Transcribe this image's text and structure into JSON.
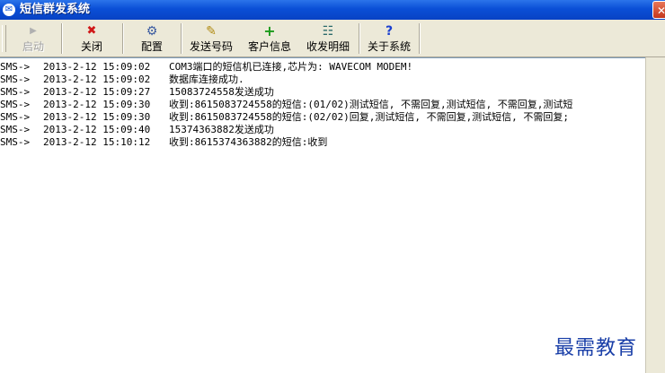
{
  "window": {
    "title": "短信群发系统",
    "close_glyph": "✕"
  },
  "toolbar": {
    "buttons": [
      {
        "label": "启动",
        "icon": "play-icon",
        "glyph": "▶",
        "enabled": false
      },
      {
        "label": "关闭",
        "icon": "close-icon",
        "glyph": "✖",
        "enabled": true
      },
      {
        "label": "配置",
        "icon": "config-icon",
        "glyph": "⚙",
        "enabled": true
      },
      {
        "label": "发送号码",
        "icon": "edit-icon",
        "glyph": "✎",
        "enabled": true
      },
      {
        "label": "客户信息",
        "icon": "add-icon",
        "glyph": "+",
        "enabled": true
      },
      {
        "label": "收发明细",
        "icon": "details-icon",
        "glyph": "☷",
        "enabled": true
      },
      {
        "label": "关于系统",
        "icon": "help-icon",
        "glyph": "?",
        "enabled": true
      }
    ]
  },
  "log": {
    "lines": [
      {
        "prefix": "SMS->",
        "time": "2013-2-12 15:09:02",
        "message": "COM3端口的短信机已连接,芯片为: WAVECOM MODEM!"
      },
      {
        "prefix": "SMS->",
        "time": "2013-2-12 15:09:02",
        "message": "数据库连接成功."
      },
      {
        "prefix": "SMS->",
        "time": "2013-2-12 15:09:27",
        "message": "15083724558发送成功"
      },
      {
        "prefix": "SMS->",
        "time": "2013-2-12 15:09:30",
        "message": "收到:8615083724558的短信:(01/02)测试短信, 不需回复,测试短信, 不需回复,测试短"
      },
      {
        "prefix": "SMS->",
        "time": "2013-2-12 15:09:30",
        "message": "收到:8615083724558的短信:(02/02)回复,测试短信, 不需回复,测试短信, 不需回复;"
      },
      {
        "prefix": "SMS->",
        "time": "2013-2-12 15:09:40",
        "message": "15374363882发送成功"
      },
      {
        "prefix": "SMS->",
        "time": "2013-2-12 15:10:12",
        "message": "收到:8615374363882的短信:收到"
      }
    ]
  },
  "watermark": "最需教育",
  "colors": {
    "titlebar": "#0a4fd6",
    "watermark": "#1a3fa8"
  }
}
